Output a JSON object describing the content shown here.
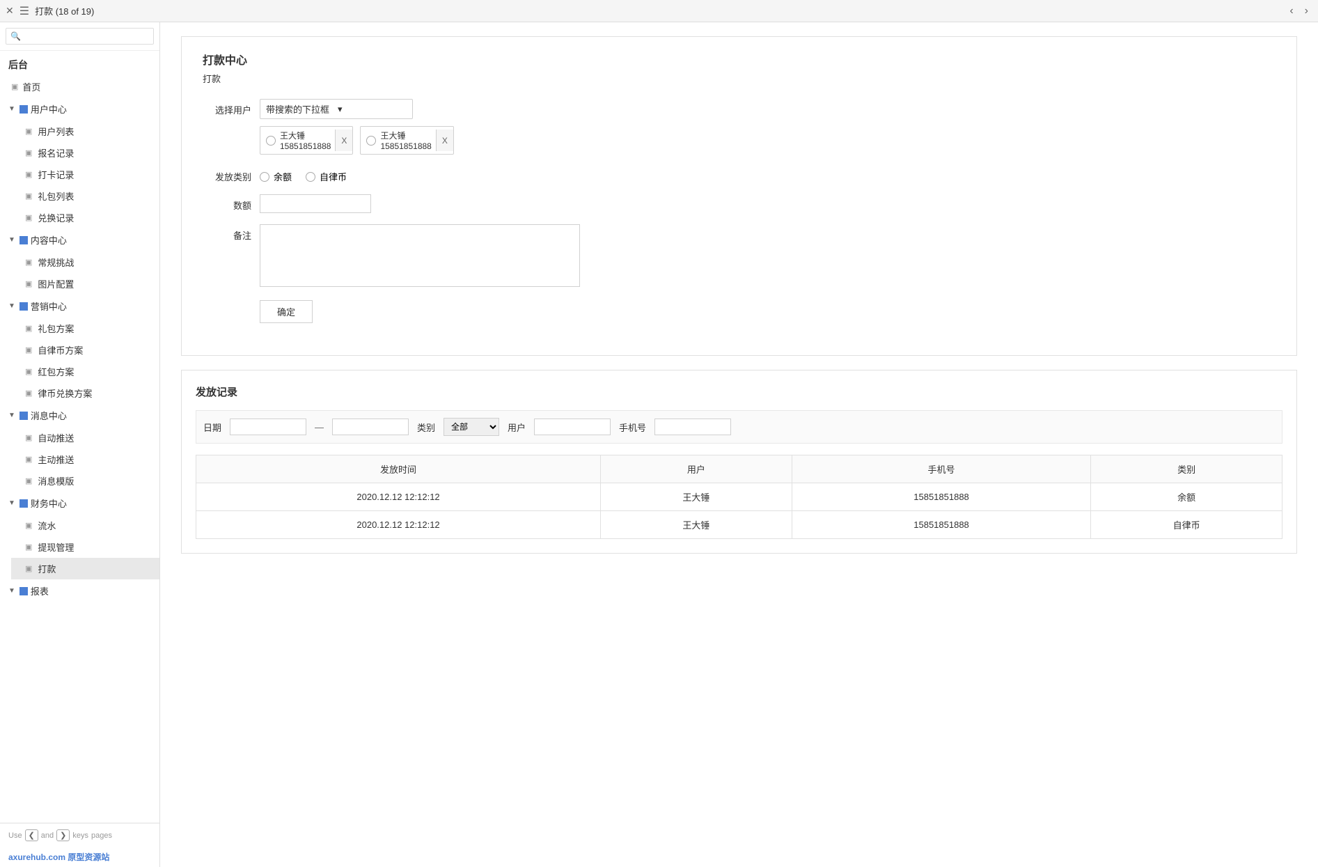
{
  "topbar": {
    "close_label": "✕",
    "menu_label": "☰",
    "title": "打款  (18 of 19)",
    "nav_prev": "‹",
    "nav_next": "›"
  },
  "sidebar": {
    "section_title": "后台",
    "search_placeholder": "",
    "items": [
      {
        "id": "home",
        "label": "首页",
        "type": "item"
      },
      {
        "id": "user-center",
        "label": "用户中心",
        "type": "group",
        "children": [
          {
            "id": "user-list",
            "label": "用户列表"
          },
          {
            "id": "registration",
            "label": "报名记录"
          },
          {
            "id": "checkin",
            "label": "打卡记录"
          },
          {
            "id": "gifts",
            "label": "礼包列表"
          },
          {
            "id": "redemption",
            "label": "兑换记录"
          }
        ]
      },
      {
        "id": "content-center",
        "label": "内容中心",
        "type": "group",
        "children": [
          {
            "id": "challenges",
            "label": "常规挑战"
          },
          {
            "id": "images",
            "label": "图片配置"
          }
        ]
      },
      {
        "id": "marketing-center",
        "label": "营销中心",
        "type": "group",
        "children": [
          {
            "id": "gift-plan",
            "label": "礼包方案"
          },
          {
            "id": "zilvb-plan",
            "label": "自律币方案"
          },
          {
            "id": "redpacket-plan",
            "label": "红包方案"
          },
          {
            "id": "exchange-plan",
            "label": "律币兑换方案"
          }
        ]
      },
      {
        "id": "message-center",
        "label": "消息中心",
        "type": "group",
        "children": [
          {
            "id": "auto-push",
            "label": "自动推送"
          },
          {
            "id": "manual-push",
            "label": "主动推送"
          },
          {
            "id": "message-template",
            "label": "消息模版"
          }
        ]
      },
      {
        "id": "finance-center",
        "label": "财务中心",
        "type": "group",
        "children": [
          {
            "id": "flow",
            "label": "流水"
          },
          {
            "id": "withdrawal",
            "label": "提现管理"
          },
          {
            "id": "payment",
            "label": "打款",
            "active": true
          }
        ]
      },
      {
        "id": "report",
        "label": "报表",
        "type": "group",
        "children": []
      }
    ],
    "footer": {
      "use_label": "Use",
      "and_label": "and",
      "keys_label": "keys",
      "pages_label": "pages",
      "prev_key": "❮",
      "next_key": "❯"
    },
    "watermark": "axurehub.com 原型资源站"
  },
  "form": {
    "title": "打款中心",
    "subtitle": "打款",
    "select_user_label": "选择用户",
    "dropdown_text": "带搜索的下拉框",
    "selected_users": [
      {
        "name": "王大锤",
        "phone": "15851851888"
      },
      {
        "name": "王大锤",
        "phone": "15851851888"
      }
    ],
    "issue_type_label": "发放类别",
    "type_options": [
      {
        "label": "余额",
        "value": "balance"
      },
      {
        "label": "自律币",
        "value": "zilvbi"
      }
    ],
    "amount_label": "数额",
    "amount_placeholder": "",
    "remark_label": "备注",
    "remark_placeholder": "",
    "confirm_btn": "确定"
  },
  "records": {
    "title": "发放记录",
    "filters": {
      "date_label": "日期",
      "date_placeholder_start": "",
      "date_placeholder_end": "",
      "type_label": "类别",
      "type_default": "全部",
      "type_options": [
        "全部",
        "余额",
        "自律币"
      ],
      "user_label": "用户",
      "user_placeholder": "",
      "phone_label": "手机号",
      "phone_placeholder": ""
    },
    "table": {
      "columns": [
        "发放时间",
        "用户",
        "手机号",
        "类别"
      ],
      "rows": [
        {
          "time": "2020.12.12 12:12:12",
          "user": "王大锤",
          "phone": "15851851888",
          "type": "余额"
        },
        {
          "time": "2020.12.12 12:12:12",
          "user": "王大锤",
          "phone": "15851851888",
          "type": "自律币"
        }
      ]
    }
  }
}
